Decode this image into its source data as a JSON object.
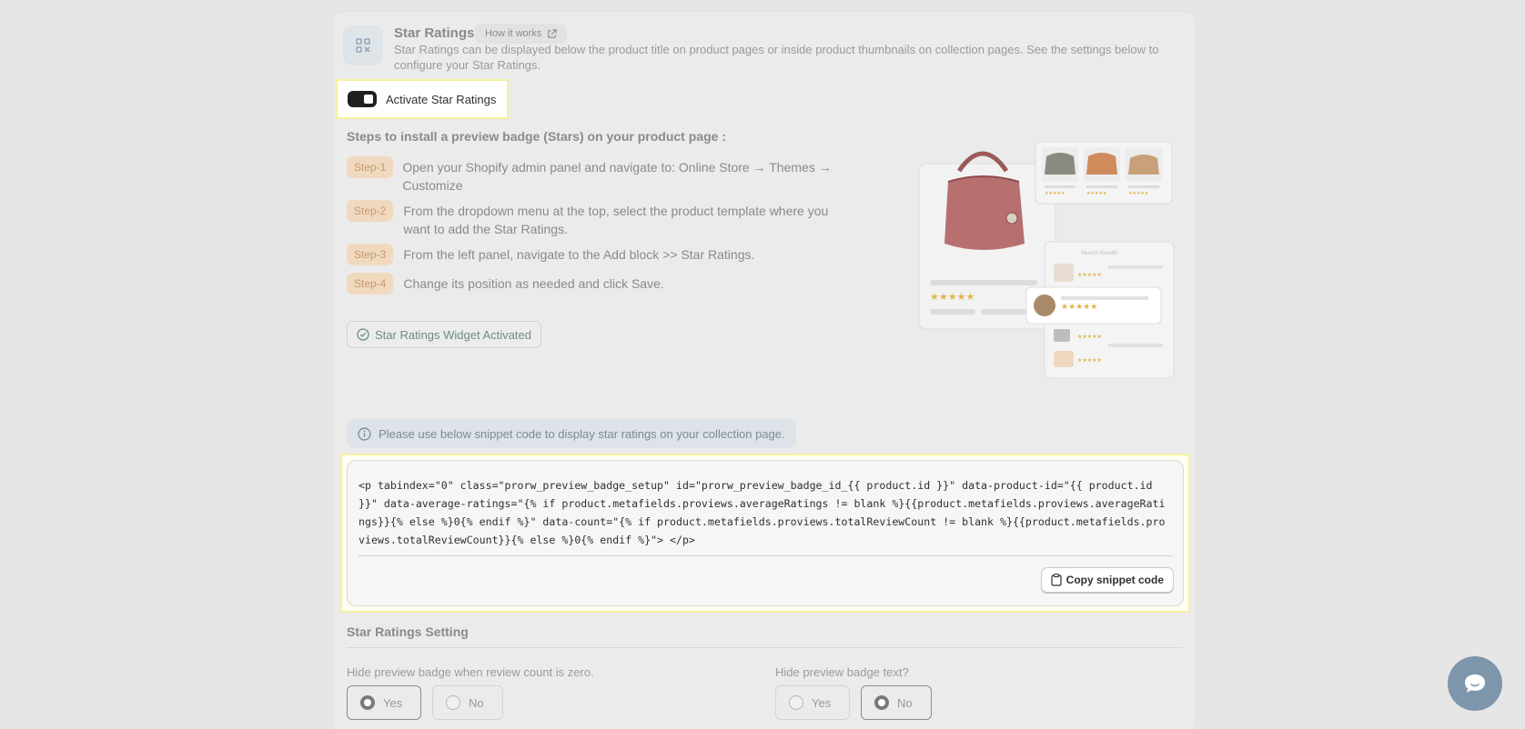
{
  "header": {
    "title": "Star Ratings",
    "how_it_works_label": "How it works",
    "description": "Star Ratings can be displayed below the product title on product pages or inside product thumbnails on collection pages. See the settings below to configure your Star Ratings."
  },
  "activate": {
    "label": "Activate Star Ratings",
    "enabled": true
  },
  "steps": {
    "title": "Steps to install a preview badge (Stars) on your product page :",
    "items": [
      {
        "badge": "Step-1",
        "text": "Open your Shopify admin panel and navigate to: Online Store → Themes → Customize"
      },
      {
        "badge": "Step-2",
        "text": "From the dropdown menu at the top, select the product template where you want to add the Star Ratings."
      },
      {
        "badge": "Step-3",
        "text": "From the left panel, navigate to the Add block >> Star Ratings."
      },
      {
        "badge": "Step-4",
        "text": "Change its position as needed and click Save."
      }
    ]
  },
  "widget_status_label": "Star Ratings Widget Activated",
  "illustration": {
    "search_results_label": "Search Results",
    "stars": "★★★★★"
  },
  "info_banner": "Please use below snippet code to display star ratings on your collection page.",
  "snippet": {
    "code": "<p tabindex=\"0\" class=\"prorw_preview_badge_setup\" id=\"prorw_preview_badge_id_{{ product.id }}\" data-product-id=\"{{ product.id }}\" data-average-ratings=\"{% if product.metafields.proviews.averageRatings != blank %}{{product.metafields.proviews.averageRatings}}{% else %}0{% endif %}\" data-count=\"{% if product.metafields.proviews.totalReviewCount != blank %}{{product.metafields.proviews.totalReviewCount}}{% else %}0{% endif %}\"> </p>",
    "copy_label": "Copy snippet code"
  },
  "settings": {
    "title": "Star Ratings Setting",
    "hide_zero": {
      "label": "Hide preview badge when review count is zero.",
      "options": [
        "Yes",
        "No"
      ],
      "selected": "Yes"
    },
    "hide_text": {
      "label": "Hide preview badge text?",
      "options": [
        "Yes",
        "No"
      ],
      "selected": "No"
    }
  },
  "colors": {
    "step_badge_bg": "#f0d9bf",
    "highlight_border": "#f5f0a0",
    "chat_bubble": "#7d96ab"
  }
}
